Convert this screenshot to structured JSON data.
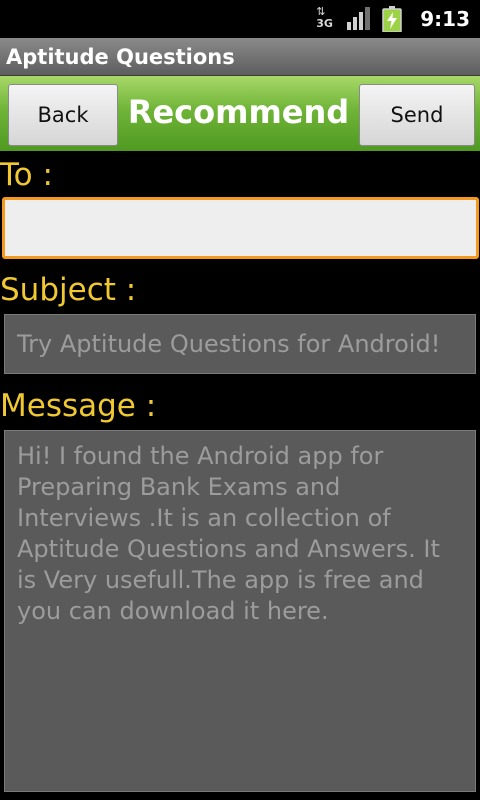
{
  "status_bar": {
    "network": "3G",
    "time": "9:13",
    "icons": [
      "data-activity-icon",
      "signal-strength-icon",
      "battery-charging-icon"
    ]
  },
  "title_bar": {
    "title": "Aptitude Questions"
  },
  "toolbar": {
    "back_label": "Back",
    "title": "Recommend",
    "send_label": "Send"
  },
  "form": {
    "to_label": "To :",
    "to_value": "",
    "subject_label": "Subject :",
    "subject_value": "Try Aptitude Questions for Android!",
    "message_label": "Message :",
    "message_lines": [
      "Hi! I found the Android app for",
      "Preparing Bank Exams and",
      "Interviews .It is an collection of",
      "Aptitude Questions and Answers. It",
      "is Very usefull.The app is free and",
      "you can download it here."
    ]
  },
  "colors": {
    "label": "#f0c832",
    "toolbar_green": "#6fb437",
    "focus_border": "#f39a1e"
  }
}
